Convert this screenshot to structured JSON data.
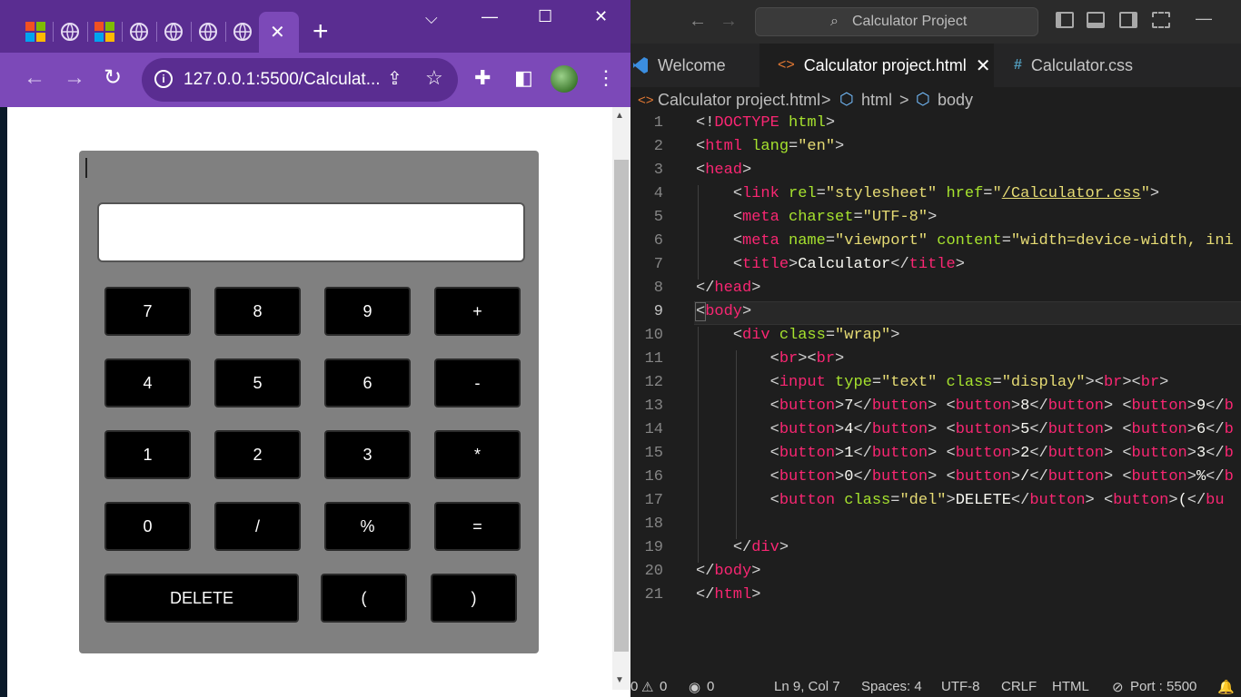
{
  "browser": {
    "new_tab_label": "+",
    "window_controls": {
      "tab_search": "⌵",
      "minimize": "—",
      "maximize": "☐",
      "close": "✕"
    },
    "active_tab_close": "✕",
    "url": "127.0.0.1:5500/Calculat...",
    "nav": {
      "back": "←",
      "forward": "→",
      "reload": "↻"
    },
    "toolbar_icons": {
      "share": "⇪",
      "star": "☆",
      "extensions": "✚",
      "sidebar": "◧",
      "menu": "⋮"
    }
  },
  "calculator": {
    "display_value": "",
    "rows": [
      [
        "7",
        "8",
        "9",
        "+"
      ],
      [
        "4",
        "5",
        "6",
        "-"
      ],
      [
        "1",
        "2",
        "3",
        "*"
      ],
      [
        "0",
        "/",
        "%",
        "="
      ]
    ],
    "last_row": {
      "delete": "DELETE",
      "open_paren": "(",
      "close_paren": ")"
    }
  },
  "vscode": {
    "command_center": "Calculator Project",
    "tabs": [
      {
        "label": "Welcome",
        "icon": "vscode-icon"
      },
      {
        "label": "Calculator project.html",
        "icon": "html-icon",
        "active": true,
        "close": "✕"
      },
      {
        "label": "Calculator.css",
        "icon": "css-hash-icon"
      }
    ],
    "breadcrumb": {
      "file": "Calculator project.html",
      "sep1": ">",
      "node1": "html",
      "sep2": ">",
      "node2": "body"
    },
    "line_numbers": [
      "1",
      "2",
      "3",
      "4",
      "5",
      "6",
      "7",
      "8",
      "9",
      "10",
      "11",
      "12",
      "13",
      "14",
      "15",
      "16",
      "17",
      "18",
      "19",
      "20",
      "21"
    ],
    "status": {
      "problems_errors": "0",
      "problems_warnings": "0",
      "ports": "0",
      "position": "Ln 9, Col 7",
      "spaces": "Spaces: 4",
      "encoding": "UTF-8",
      "eol": "CRLF",
      "language": "HTML",
      "port": "Port : 5500"
    }
  },
  "colors": {
    "browser_frame": "#7c49b8",
    "calculator_body": "#808080",
    "button_bg": "#000000",
    "editor_bg": "#1e1e1e",
    "tag": "#f92672",
    "attr": "#a6e22e",
    "string": "#e6db74"
  }
}
